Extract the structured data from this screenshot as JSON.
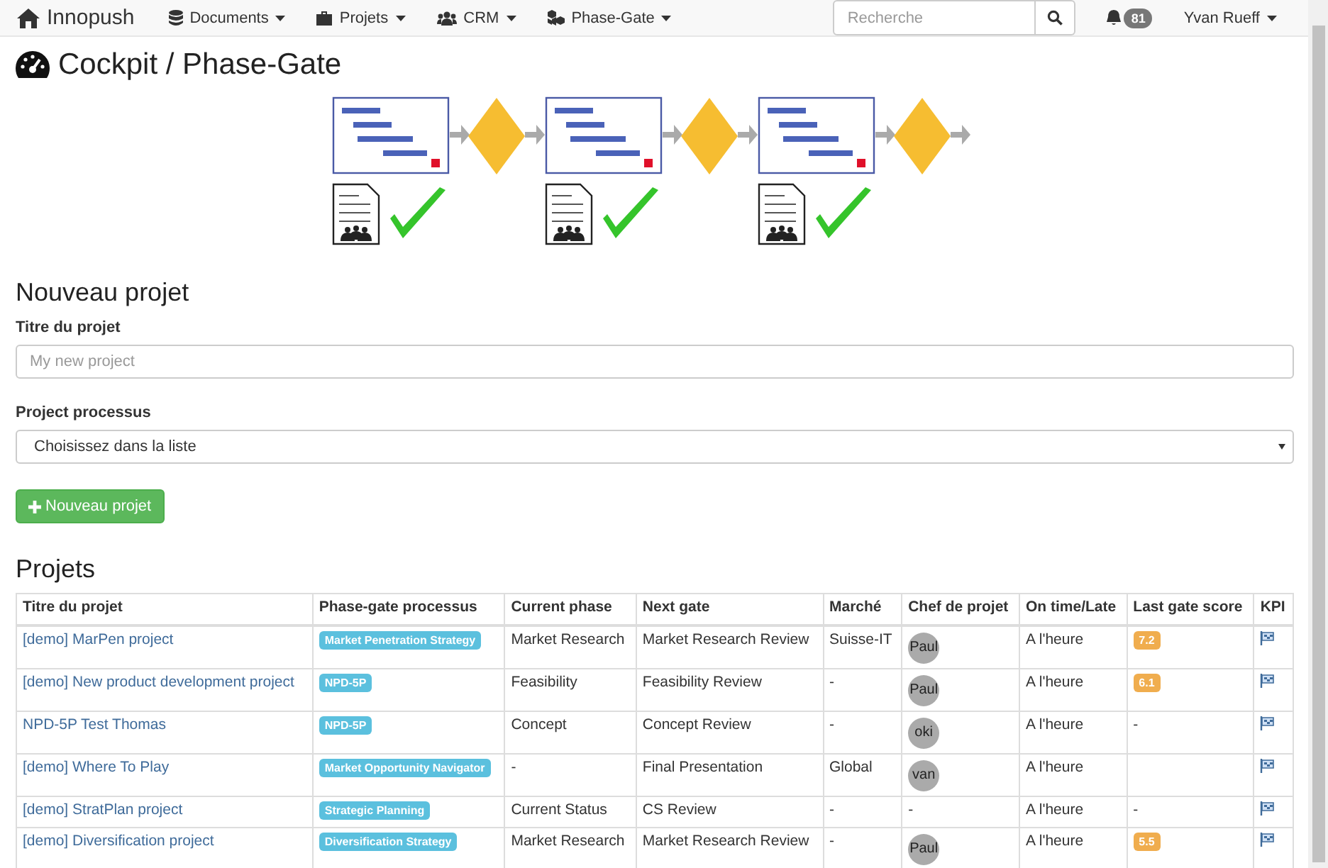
{
  "navbar": {
    "brand": "Innopush",
    "menus": [
      {
        "label": "Documents"
      },
      {
        "label": "Projets"
      },
      {
        "label": "CRM"
      },
      {
        "label": "Phase-Gate"
      }
    ],
    "search": {
      "placeholder": "Recherche"
    },
    "notifications": "81",
    "user": "Yvan Rueff"
  },
  "page_title": "Cockpit / Phase-Gate",
  "new_project": {
    "heading": "Nouveau projet",
    "title_label": "Titre du projet",
    "title_placeholder": "My new project",
    "process_label": "Project processus",
    "process_value": "Choisissez dans la liste",
    "button": "Nouveau projet"
  },
  "projects": {
    "heading": "Projets",
    "columns": [
      "Titre du projet",
      "Phase-gate processus",
      "Current phase",
      "Next gate",
      "Marché",
      "Chef de projet",
      "On time/Late",
      "Last gate score",
      "KPI"
    ],
    "rows": [
      {
        "title": "[demo] MarPen project",
        "process": "Market Penetration Strategy",
        "phase": "Market Research",
        "gate": "Market Research Review",
        "market": "Suisse-IT",
        "manager": {
          "kind": "avatar",
          "text": "Paul"
        },
        "status": "A l'heure",
        "score": {
          "kind": "badge",
          "text": "7.2"
        }
      },
      {
        "title": "[demo] New product development project",
        "process": "NPD-5P",
        "phase": "Feasibility",
        "gate": "Feasibility Review",
        "market": "-",
        "manager": {
          "kind": "avatar",
          "text": "Paul"
        },
        "status": "A l'heure",
        "score": {
          "kind": "badge",
          "text": "6.1"
        }
      },
      {
        "title": "NPD-5P Test Thomas",
        "process": "NPD-5P",
        "phase": "Concept",
        "gate": "Concept Review",
        "market": "-",
        "manager": {
          "kind": "avatar",
          "text": "oki"
        },
        "status": "A l'heure",
        "score": {
          "kind": "text",
          "text": "-"
        }
      },
      {
        "title": "[demo] Where To Play",
        "process": "Market Opportunity Navigator",
        "phase": "-",
        "gate": "Final Presentation",
        "market": "Global",
        "manager": {
          "kind": "avatar",
          "text": "van"
        },
        "status": "A l'heure"
      },
      {
        "title": "[demo] StratPlan project",
        "process": "Strategic Planning",
        "phase": "Current Status",
        "gate": "CS Review",
        "market": "-",
        "manager": {
          "kind": "text",
          "text": "-"
        },
        "status": "A l'heure",
        "score": {
          "kind": "text",
          "text": "-"
        }
      },
      {
        "title": "[demo] Diversification project",
        "process": "Diversification Strategy",
        "phase": "Market Research",
        "gate": "Market Research Review",
        "market": "-",
        "manager": {
          "kind": "avatar",
          "text": "Paul"
        },
        "status": "A l'heure",
        "score": {
          "kind": "badge",
          "text": "5.5"
        }
      }
    ]
  }
}
